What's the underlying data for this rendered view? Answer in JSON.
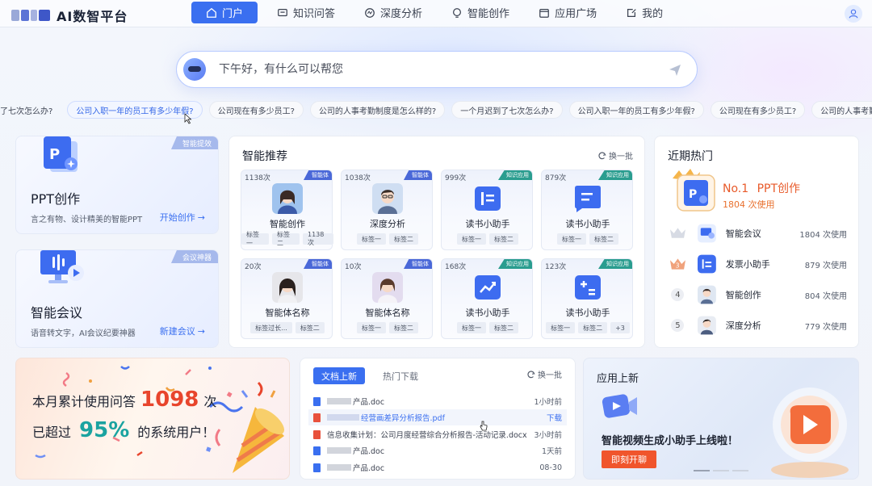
{
  "app": {
    "title": "AI数智平台"
  },
  "nav": {
    "items": [
      {
        "label": "门户",
        "icon": "home-icon",
        "active": true
      },
      {
        "label": "知识问答",
        "icon": "chat-icon",
        "active": false
      },
      {
        "label": "深度分析",
        "icon": "analysis-icon",
        "active": false
      },
      {
        "label": "智能创作",
        "icon": "bulb-icon",
        "active": false
      },
      {
        "label": "应用广场",
        "icon": "app-store-icon",
        "active": false
      },
      {
        "label": "我的",
        "icon": "my-icon",
        "active": false
      }
    ]
  },
  "search": {
    "placeholder": "下午好，有什么可以帮您"
  },
  "suggestions": [
    "了七次怎么办?",
    "公司入职一年的员工有多少年假?",
    "公司现在有多少员工?",
    "公司的人事考勤制度是怎么样的?",
    "一个月迟到了七次怎么办?",
    "公司入职一年的员工有多少年假?",
    "公司现在有多少员工?",
    "公司的人事考勤制度是怎么样的?"
  ],
  "left_cards": [
    {
      "tag": "智能提效",
      "title": "PPT创作",
      "desc": "言之有物、设计精美的智能PPT",
      "action": "开始创作"
    },
    {
      "tag": "会议神器",
      "title": "智能会议",
      "desc": "语音转文字，AI会议纪要神器",
      "action": "新建会议"
    }
  ],
  "recommend": {
    "title": "智能推荐",
    "refresh": "换一批",
    "cards": [
      {
        "count": "1138次",
        "badge": "智能体",
        "name": "智能创作",
        "tags": [
          "标签一",
          "标签二",
          "1138次"
        ]
      },
      {
        "count": "1038次",
        "badge": "智能体",
        "name": "深度分析",
        "tags": [
          "标签一",
          "标签二"
        ]
      },
      {
        "count": "999次",
        "badge": "知识应用",
        "name": "读书小助手",
        "tags": [
          "标签一",
          "标签二"
        ]
      },
      {
        "count": "879次",
        "badge": "知识应用",
        "name": "读书小助手",
        "tags": [
          "标签一",
          "标签二"
        ]
      },
      {
        "count": "20次",
        "badge": "智能体",
        "name": "智能体名称",
        "tags": [
          "标签过长...",
          "标签二"
        ]
      },
      {
        "count": "10次",
        "badge": "智能体",
        "name": "智能体名称",
        "tags": [
          "标签一",
          "标签二"
        ]
      },
      {
        "count": "168次",
        "badge": "知识应用",
        "name": "读书小助手",
        "tags": [
          "标签一",
          "标签二"
        ]
      },
      {
        "count": "123次",
        "badge": "知识应用",
        "name": "读书小助手",
        "tags": [
          "标签一",
          "标签二",
          "+3"
        ]
      }
    ]
  },
  "hot": {
    "title": "近期热门",
    "top": {
      "rank": "No.1",
      "name": "PPT创作",
      "count": "1804 次使用"
    },
    "items": [
      {
        "rank": "2",
        "name": "智能会议",
        "count": "1804 次使用"
      },
      {
        "rank": "3",
        "name": "发票小助手",
        "count": "879 次使用"
      },
      {
        "rank": "4",
        "name": "智能创作",
        "count": "804 次使用"
      },
      {
        "rank": "5",
        "name": "深度分析",
        "count": "779 次使用"
      }
    ]
  },
  "stats_banner": {
    "line1_pre": "本月累计使用问答",
    "line1_num": "1098",
    "line1_post": "次",
    "line2_pre": "已超过",
    "line2_num": "95%",
    "line2_post": "的系统用户！"
  },
  "docs": {
    "tabs": [
      "文档上新",
      "热门下载"
    ],
    "refresh": "换一批",
    "rows": [
      {
        "name": "产品.doc",
        "time": "1小时前",
        "type": "doc"
      },
      {
        "name": "经营画差异分析报告.pdf",
        "time": "下载",
        "type": "pdf"
      },
      {
        "name": "信息收集计划：公司月度经营综合分析报告-活动记录.docx",
        "time": "3小时前",
        "type": "pdf"
      },
      {
        "name": "产品.doc",
        "time": "1天前",
        "type": "doc"
      },
      {
        "name": "产品.doc",
        "time": "08-30",
        "type": "doc"
      }
    ]
  },
  "app_banner": {
    "title": "应用上新",
    "headline": "智能视频生成小助手上线啦！",
    "button": "即刻开聊"
  },
  "colors": {
    "primary": "#3a6ff0",
    "accent_red": "#e8452c",
    "accent_teal": "#1aa3a0"
  }
}
